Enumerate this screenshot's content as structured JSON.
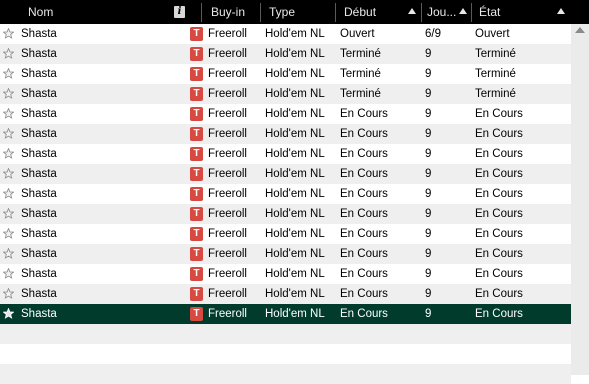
{
  "columns": {
    "name": "Nom",
    "buyin": "Buy-in",
    "type": "Type",
    "start": "Début",
    "players": "Jou...",
    "state": "État"
  },
  "info_icon_glyph": "i",
  "tournament_icon_glyph": "T",
  "colors": {
    "header_bg": "#000000",
    "selected_row": "#003b2c",
    "tournament_icon": "#d64a42",
    "alt_row": "#efefef"
  },
  "rows": [
    {
      "name": "Shasta",
      "buyin": "Freeroll",
      "type": "Hold'em NL",
      "start": "Ouvert",
      "players": "6/9",
      "state": "Ouvert"
    },
    {
      "name": "Shasta",
      "buyin": "Freeroll",
      "type": "Hold'em NL",
      "start": "Terminé",
      "players": "9",
      "state": "Terminé"
    },
    {
      "name": "Shasta",
      "buyin": "Freeroll",
      "type": "Hold'em NL",
      "start": "Terminé",
      "players": "9",
      "state": "Terminé"
    },
    {
      "name": "Shasta",
      "buyin": "Freeroll",
      "type": "Hold'em NL",
      "start": "Terminé",
      "players": "9",
      "state": "Terminé"
    },
    {
      "name": "Shasta",
      "buyin": "Freeroll",
      "type": "Hold'em NL",
      "start": "En Cours",
      "players": "9",
      "state": "En Cours"
    },
    {
      "name": "Shasta",
      "buyin": "Freeroll",
      "type": "Hold'em NL",
      "start": "En Cours",
      "players": "9",
      "state": "En Cours"
    },
    {
      "name": "Shasta",
      "buyin": "Freeroll",
      "type": "Hold'em NL",
      "start": "En Cours",
      "players": "9",
      "state": "En Cours"
    },
    {
      "name": "Shasta",
      "buyin": "Freeroll",
      "type": "Hold'em NL",
      "start": "En Cours",
      "players": "9",
      "state": "En Cours"
    },
    {
      "name": "Shasta",
      "buyin": "Freeroll",
      "type": "Hold'em NL",
      "start": "En Cours",
      "players": "9",
      "state": "En Cours"
    },
    {
      "name": "Shasta",
      "buyin": "Freeroll",
      "type": "Hold'em NL",
      "start": "En Cours",
      "players": "9",
      "state": "En Cours"
    },
    {
      "name": "Shasta",
      "buyin": "Freeroll",
      "type": "Hold'em NL",
      "start": "En Cours",
      "players": "9",
      "state": "En Cours"
    },
    {
      "name": "Shasta",
      "buyin": "Freeroll",
      "type": "Hold'em NL",
      "start": "En Cours",
      "players": "9",
      "state": "En Cours"
    },
    {
      "name": "Shasta",
      "buyin": "Freeroll",
      "type": "Hold'em NL",
      "start": "En Cours",
      "players": "9",
      "state": "En Cours"
    },
    {
      "name": "Shasta",
      "buyin": "Freeroll",
      "type": "Hold'em NL",
      "start": "En Cours",
      "players": "9",
      "state": "En Cours"
    },
    {
      "name": "Shasta",
      "buyin": "Freeroll",
      "type": "Hold'em NL",
      "start": "En Cours",
      "players": "9",
      "state": "En Cours",
      "selected": true
    }
  ]
}
